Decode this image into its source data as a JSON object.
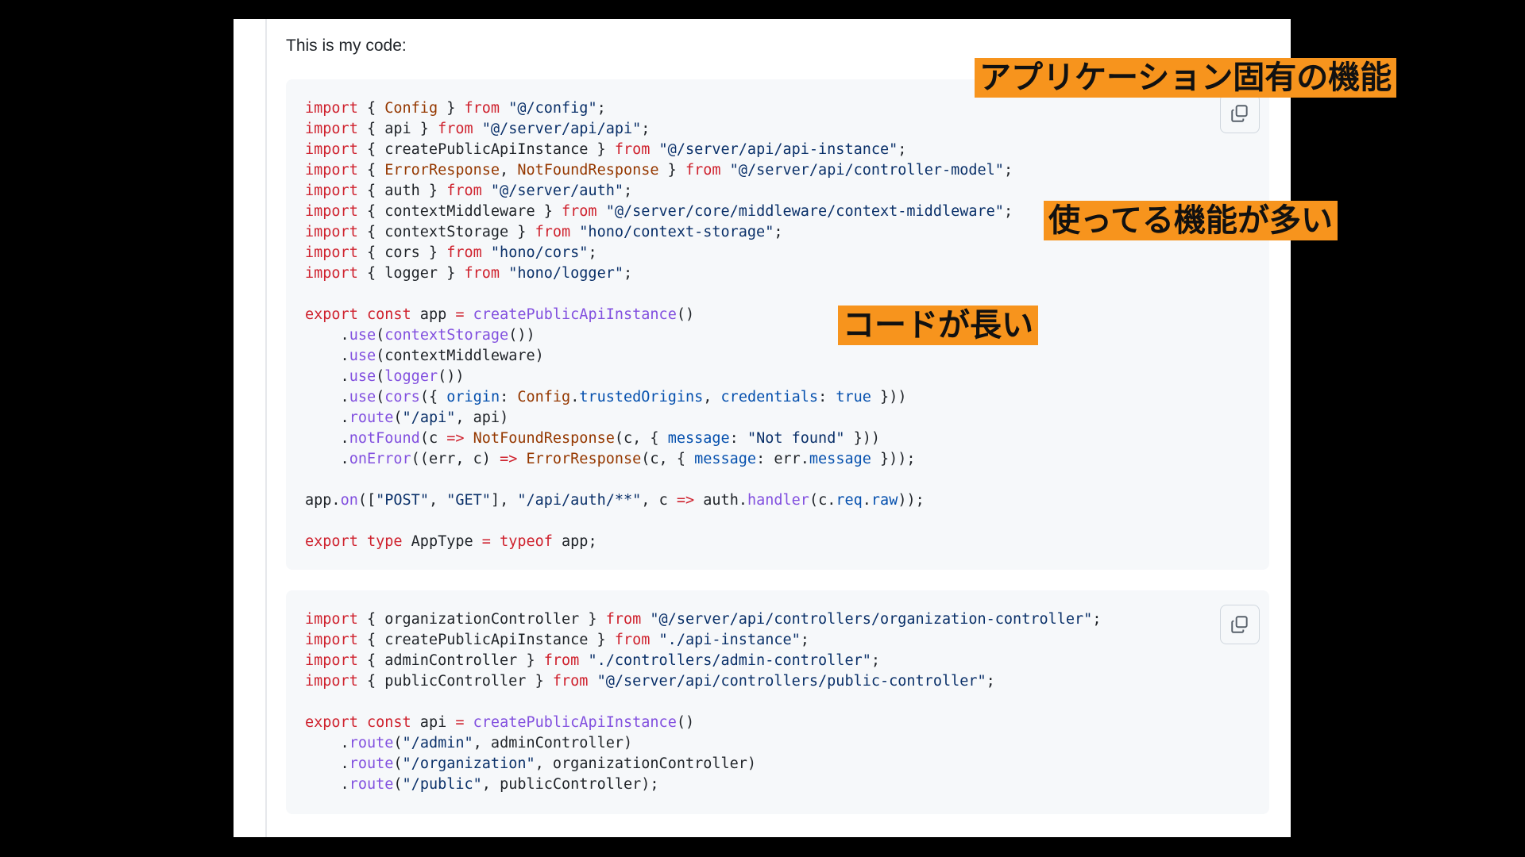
{
  "intro_text": "This is my code:",
  "annotations": {
    "app_specific": "アプリケーション固有の機能",
    "many_features": "使ってる機能が多い",
    "code_long": "コードが長い"
  },
  "copy_button": {
    "icon": "copy-icon"
  },
  "code_blocks": [
    {
      "lines": [
        [
          [
            "kw",
            "import"
          ],
          [
            "p",
            " { "
          ],
          [
            "type",
            "Config"
          ],
          [
            "p",
            " } "
          ],
          [
            "kw",
            "from"
          ],
          [
            "p",
            " "
          ],
          [
            "str",
            "\"@/config\""
          ],
          [
            "p",
            ";"
          ]
        ],
        [
          [
            "kw",
            "import"
          ],
          [
            "p",
            " { api } "
          ],
          [
            "kw",
            "from"
          ],
          [
            "p",
            " "
          ],
          [
            "str",
            "\"@/server/api/api\""
          ],
          [
            "p",
            ";"
          ]
        ],
        [
          [
            "kw",
            "import"
          ],
          [
            "p",
            " { createPublicApiInstance } "
          ],
          [
            "kw",
            "from"
          ],
          [
            "p",
            " "
          ],
          [
            "str",
            "\"@/server/api/api-instance\""
          ],
          [
            "p",
            ";"
          ]
        ],
        [
          [
            "kw",
            "import"
          ],
          [
            "p",
            " { "
          ],
          [
            "type",
            "ErrorResponse"
          ],
          [
            "p",
            ", "
          ],
          [
            "type",
            "NotFoundResponse"
          ],
          [
            "p",
            " } "
          ],
          [
            "kw",
            "from"
          ],
          [
            "p",
            " "
          ],
          [
            "str",
            "\"@/server/api/controller-model\""
          ],
          [
            "p",
            ";"
          ]
        ],
        [
          [
            "kw",
            "import"
          ],
          [
            "p",
            " { auth } "
          ],
          [
            "kw",
            "from"
          ],
          [
            "p",
            " "
          ],
          [
            "str",
            "\"@/server/auth\""
          ],
          [
            "p",
            ";"
          ]
        ],
        [
          [
            "kw",
            "import"
          ],
          [
            "p",
            " { contextMiddleware } "
          ],
          [
            "kw",
            "from"
          ],
          [
            "p",
            " "
          ],
          [
            "str",
            "\"@/server/core/middleware/context-middleware\""
          ],
          [
            "p",
            ";"
          ]
        ],
        [
          [
            "kw",
            "import"
          ],
          [
            "p",
            " { contextStorage } "
          ],
          [
            "kw",
            "from"
          ],
          [
            "p",
            " "
          ],
          [
            "str",
            "\"hono/context-storage\""
          ],
          [
            "p",
            ";"
          ]
        ],
        [
          [
            "kw",
            "import"
          ],
          [
            "p",
            " { cors } "
          ],
          [
            "kw",
            "from"
          ],
          [
            "p",
            " "
          ],
          [
            "str",
            "\"hono/cors\""
          ],
          [
            "p",
            ";"
          ]
        ],
        [
          [
            "kw",
            "import"
          ],
          [
            "p",
            " { logger } "
          ],
          [
            "kw",
            "from"
          ],
          [
            "p",
            " "
          ],
          [
            "str",
            "\"hono/logger\""
          ],
          [
            "p",
            ";"
          ]
        ],
        [],
        [
          [
            "kw",
            "export"
          ],
          [
            "p",
            " "
          ],
          [
            "kw",
            "const"
          ],
          [
            "p",
            " app "
          ],
          [
            "kw",
            "="
          ],
          [
            "p",
            " "
          ],
          [
            "fn",
            "createPublicApiInstance"
          ],
          [
            "p",
            "()"
          ]
        ],
        [
          [
            "p",
            "    ."
          ],
          [
            "fn",
            "use"
          ],
          [
            "p",
            "("
          ],
          [
            "fn",
            "contextStorage"
          ],
          [
            "p",
            "())"
          ]
        ],
        [
          [
            "p",
            "    ."
          ],
          [
            "fn",
            "use"
          ],
          [
            "p",
            "(contextMiddleware)"
          ]
        ],
        [
          [
            "p",
            "    ."
          ],
          [
            "fn",
            "use"
          ],
          [
            "p",
            "("
          ],
          [
            "fn",
            "logger"
          ],
          [
            "p",
            "())"
          ]
        ],
        [
          [
            "p",
            "    ."
          ],
          [
            "fn",
            "use"
          ],
          [
            "p",
            "("
          ],
          [
            "fn",
            "cors"
          ],
          [
            "p",
            "({ "
          ],
          [
            "const",
            "origin"
          ],
          [
            "p",
            ": "
          ],
          [
            "type",
            "Config"
          ],
          [
            "p",
            "."
          ],
          [
            "const",
            "trustedOrigins"
          ],
          [
            "p",
            ", "
          ],
          [
            "const",
            "credentials"
          ],
          [
            "p",
            ": "
          ],
          [
            "const",
            "true"
          ],
          [
            "p",
            " }))"
          ]
        ],
        [
          [
            "p",
            "    ."
          ],
          [
            "fn",
            "route"
          ],
          [
            "p",
            "("
          ],
          [
            "str",
            "\"/api\""
          ],
          [
            "p",
            ", api)"
          ]
        ],
        [
          [
            "p",
            "    ."
          ],
          [
            "fn",
            "notFound"
          ],
          [
            "p",
            "(c "
          ],
          [
            "kw",
            "=>"
          ],
          [
            "p",
            " "
          ],
          [
            "type",
            "NotFoundResponse"
          ],
          [
            "p",
            "(c, { "
          ],
          [
            "const",
            "message"
          ],
          [
            "p",
            ": "
          ],
          [
            "str",
            "\"Not found\""
          ],
          [
            "p",
            " }))"
          ]
        ],
        [
          [
            "p",
            "    ."
          ],
          [
            "fn",
            "onError"
          ],
          [
            "p",
            "((err, c) "
          ],
          [
            "kw",
            "=>"
          ],
          [
            "p",
            " "
          ],
          [
            "type",
            "ErrorResponse"
          ],
          [
            "p",
            "(c, { "
          ],
          [
            "const",
            "message"
          ],
          [
            "p",
            ": err."
          ],
          [
            "const",
            "message"
          ],
          [
            "p",
            " }));"
          ]
        ],
        [],
        [
          [
            "p",
            "app."
          ],
          [
            "fn",
            "on"
          ],
          [
            "p",
            "(["
          ],
          [
            "str",
            "\"POST\""
          ],
          [
            "p",
            ", "
          ],
          [
            "str",
            "\"GET\""
          ],
          [
            "p",
            "], "
          ],
          [
            "str",
            "\"/api/auth/**\""
          ],
          [
            "p",
            ", c "
          ],
          [
            "kw",
            "=>"
          ],
          [
            "p",
            " auth."
          ],
          [
            "fn",
            "handler"
          ],
          [
            "p",
            "(c."
          ],
          [
            "const",
            "req"
          ],
          [
            "p",
            "."
          ],
          [
            "const",
            "raw"
          ],
          [
            "p",
            "));"
          ]
        ],
        [],
        [
          [
            "kw",
            "export"
          ],
          [
            "p",
            " "
          ],
          [
            "kw",
            "type"
          ],
          [
            "p",
            " AppType "
          ],
          [
            "kw",
            "="
          ],
          [
            "p",
            " "
          ],
          [
            "kw",
            "typeof"
          ],
          [
            "p",
            " app;"
          ]
        ]
      ]
    },
    {
      "lines": [
        [
          [
            "kw",
            "import"
          ],
          [
            "p",
            " { organizationController } "
          ],
          [
            "kw",
            "from"
          ],
          [
            "p",
            " "
          ],
          [
            "str",
            "\"@/server/api/controllers/organization-controller\""
          ],
          [
            "p",
            ";"
          ]
        ],
        [
          [
            "kw",
            "import"
          ],
          [
            "p",
            " { createPublicApiInstance } "
          ],
          [
            "kw",
            "from"
          ],
          [
            "p",
            " "
          ],
          [
            "str",
            "\"./api-instance\""
          ],
          [
            "p",
            ";"
          ]
        ],
        [
          [
            "kw",
            "import"
          ],
          [
            "p",
            " { adminController } "
          ],
          [
            "kw",
            "from"
          ],
          [
            "p",
            " "
          ],
          [
            "str",
            "\"./controllers/admin-controller\""
          ],
          [
            "p",
            ";"
          ]
        ],
        [
          [
            "kw",
            "import"
          ],
          [
            "p",
            " { publicController } "
          ],
          [
            "kw",
            "from"
          ],
          [
            "p",
            " "
          ],
          [
            "str",
            "\"@/server/api/controllers/public-controller\""
          ],
          [
            "p",
            ";"
          ]
        ],
        [],
        [
          [
            "kw",
            "export"
          ],
          [
            "p",
            " "
          ],
          [
            "kw",
            "const"
          ],
          [
            "p",
            " api "
          ],
          [
            "kw",
            "="
          ],
          [
            "p",
            " "
          ],
          [
            "fn",
            "createPublicApiInstance"
          ],
          [
            "p",
            "()"
          ]
        ],
        [
          [
            "p",
            "    ."
          ],
          [
            "fn",
            "route"
          ],
          [
            "p",
            "("
          ],
          [
            "str",
            "\"/admin\""
          ],
          [
            "p",
            ", adminController)"
          ]
        ],
        [
          [
            "p",
            "    ."
          ],
          [
            "fn",
            "route"
          ],
          [
            "p",
            "("
          ],
          [
            "str",
            "\"/organization\""
          ],
          [
            "p",
            ", organizationController)"
          ]
        ],
        [
          [
            "p",
            "    ."
          ],
          [
            "fn",
            "route"
          ],
          [
            "p",
            "("
          ],
          [
            "str",
            "\"/public\""
          ],
          [
            "p",
            ", publicController);"
          ]
        ]
      ]
    }
  ]
}
